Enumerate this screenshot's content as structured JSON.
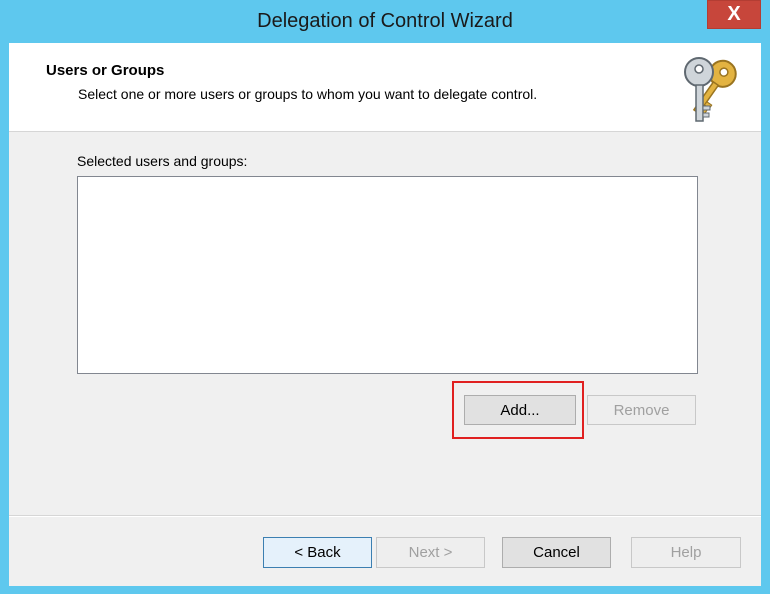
{
  "window": {
    "title": "Delegation of Control Wizard",
    "close_glyph": "X"
  },
  "header": {
    "title": "Users or Groups",
    "subtitle": "Select one or more users or groups to whom you want to delegate control.",
    "icon": "keys-icon"
  },
  "list": {
    "label": "Selected users and groups:",
    "items": []
  },
  "list_buttons": {
    "add": "Add...",
    "remove": "Remove"
  },
  "footer": {
    "back": "< Back",
    "next": "Next >",
    "cancel": "Cancel",
    "help": "Help"
  },
  "colors": {
    "title_bar": "#5ec8ee",
    "close_button": "#c7463b",
    "highlight": "#e02020"
  }
}
